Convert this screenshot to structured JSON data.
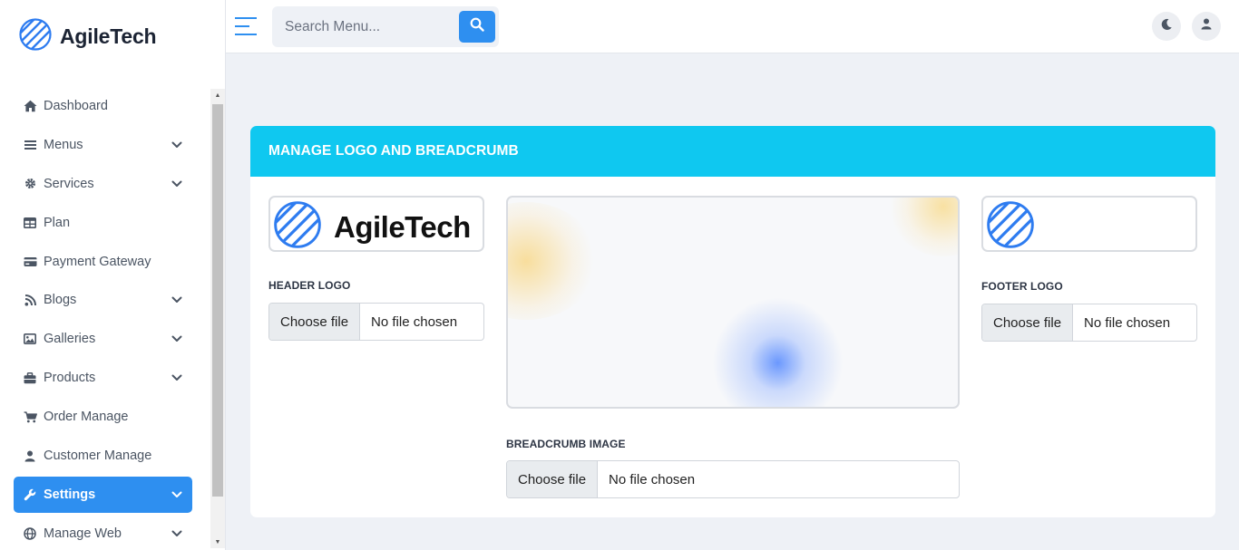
{
  "brand": {
    "name": "AgileTech",
    "accent": "#2e8ff0"
  },
  "sidebar": {
    "items": [
      {
        "label": "Dashboard",
        "icon": "home-icon",
        "has_submenu": false,
        "active": false
      },
      {
        "label": "Menus",
        "icon": "bars-icon",
        "has_submenu": true,
        "active": false
      },
      {
        "label": "Services",
        "icon": "gear-icon",
        "has_submenu": true,
        "active": false
      },
      {
        "label": "Plan",
        "icon": "table-icon",
        "has_submenu": false,
        "active": false
      },
      {
        "label": "Payment Gateway",
        "icon": "credit-card-icon",
        "has_submenu": false,
        "active": false
      },
      {
        "label": "Blogs",
        "icon": "blog-icon",
        "has_submenu": true,
        "active": false
      },
      {
        "label": "Galleries",
        "icon": "image-icon",
        "has_submenu": true,
        "active": false
      },
      {
        "label": "Products",
        "icon": "briefcase-icon",
        "has_submenu": true,
        "active": false
      },
      {
        "label": "Order Manage",
        "icon": "cart-icon",
        "has_submenu": false,
        "active": false
      },
      {
        "label": "Customer Manage",
        "icon": "user-icon",
        "has_submenu": false,
        "active": false
      },
      {
        "label": "Settings",
        "icon": "wrench-icon",
        "has_submenu": true,
        "active": true
      },
      {
        "label": "Manage Web",
        "icon": "globe-icon",
        "has_submenu": true,
        "active": false
      }
    ]
  },
  "topbar": {
    "search": {
      "placeholder": "Search Menu...",
      "value": ""
    },
    "icons": [
      "menu-toggle-icon",
      "search-icon",
      "moon-icon",
      "user-icon"
    ]
  },
  "card": {
    "title": "MANAGE LOGO AND BREADCRUMB",
    "header_color": "#0fc8f0",
    "header_logo": {
      "label": "HEADER LOGO",
      "button": "Choose file",
      "status": "No file chosen",
      "preview_text": "AgileTech"
    },
    "breadcrumb_image": {
      "label": "BREADCRUMB IMAGE",
      "button": "Choose file",
      "status": "No file chosen"
    },
    "footer_logo": {
      "label": "FOOTER LOGO",
      "button": "Choose file",
      "status": "No file chosen"
    }
  }
}
